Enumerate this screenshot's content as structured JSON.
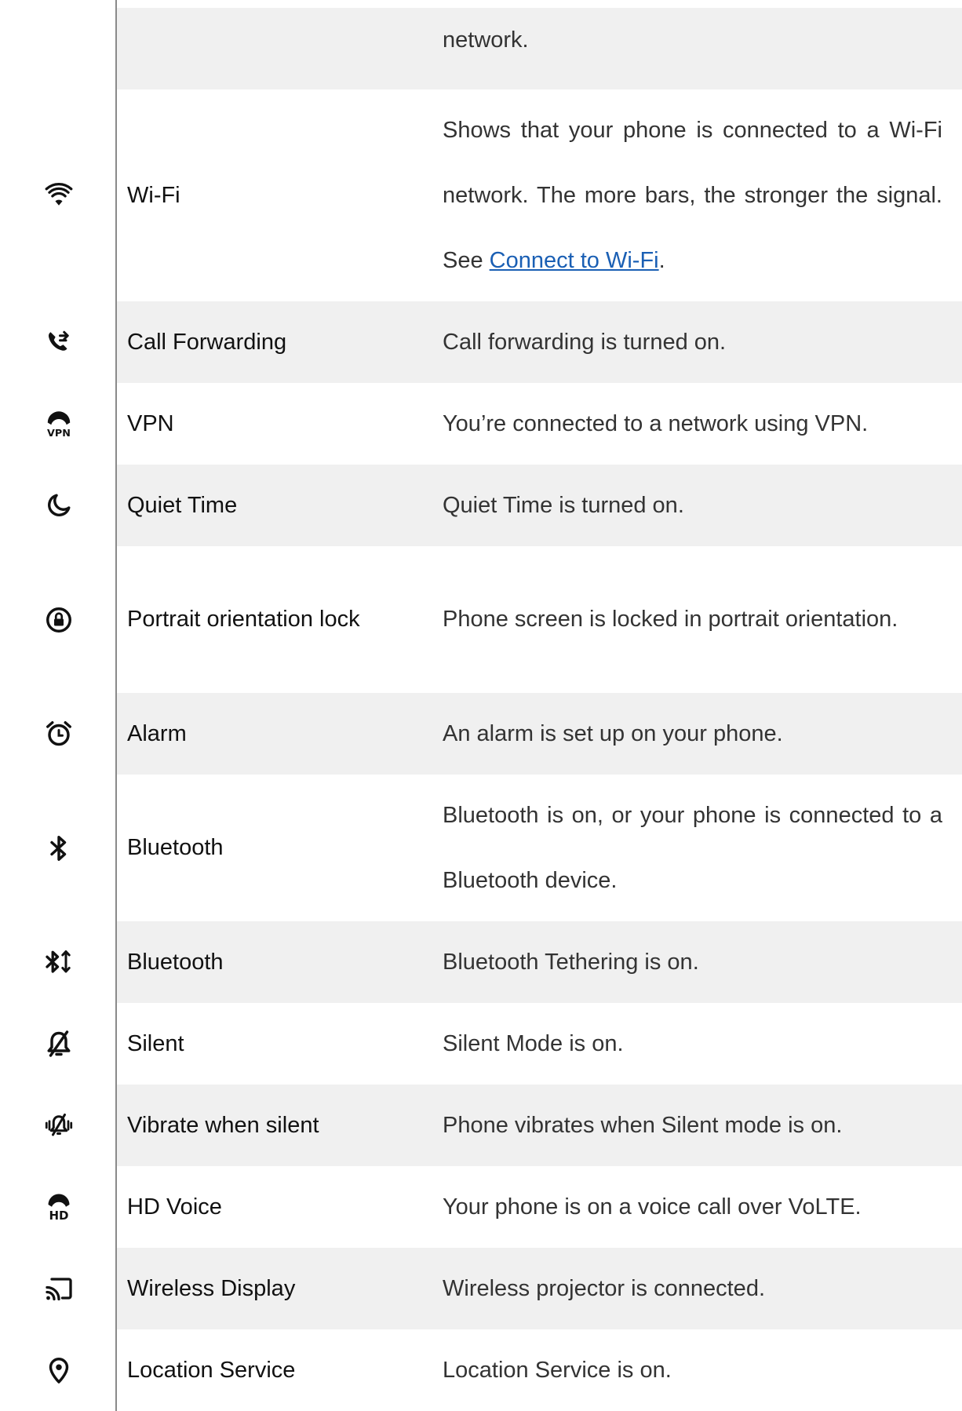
{
  "rows": [
    {
      "name": "",
      "description": "network."
    },
    {
      "name": "Wi-Fi",
      "description_pre": "Shows that your phone is connected to a Wi-Fi network. The more bars, the stronger the signal. See ",
      "link_text": "Connect to Wi-Fi",
      "description_post": ".",
      "icon": "wifi-icon"
    },
    {
      "name": "Call Forwarding",
      "description": "Call forwarding is turned on.",
      "icon": "call-forwarding-icon"
    },
    {
      "name": "VPN",
      "description": "You’re connected to a network using VPN.",
      "icon": "vpn-icon"
    },
    {
      "name": "Quiet Time",
      "description": "Quiet Time is turned on.",
      "icon": "moon-icon"
    },
    {
      "name": "Portrait orientation lock",
      "description": "Phone screen is locked in portrait orientation.",
      "icon": "orientation-lock-icon"
    },
    {
      "name": "Alarm",
      "description": "An alarm is set up on your phone.",
      "icon": "alarm-icon"
    },
    {
      "name": "Bluetooth",
      "description": "Bluetooth is on, or your phone is connected to a Bluetooth device.",
      "icon": "bluetooth-icon"
    },
    {
      "name": "Bluetooth",
      "description": "Bluetooth Tethering is on.",
      "icon": "bluetooth-tethering-icon"
    },
    {
      "name": "Silent",
      "description": "Silent Mode is on.",
      "icon": "silent-icon"
    },
    {
      "name": "Vibrate when silent",
      "description": "Phone vibrates when Silent mode is on.",
      "icon": "vibrate-icon"
    },
    {
      "name": "HD Voice",
      "description": "Your phone is on a voice call over VoLTE.",
      "icon": "hd-voice-icon"
    },
    {
      "name": "Wireless Display",
      "description": "Wireless projector is connected.",
      "icon": "cast-icon"
    },
    {
      "name": "Location Service",
      "description": "Location Service is on.",
      "icon": "location-icon"
    }
  ]
}
